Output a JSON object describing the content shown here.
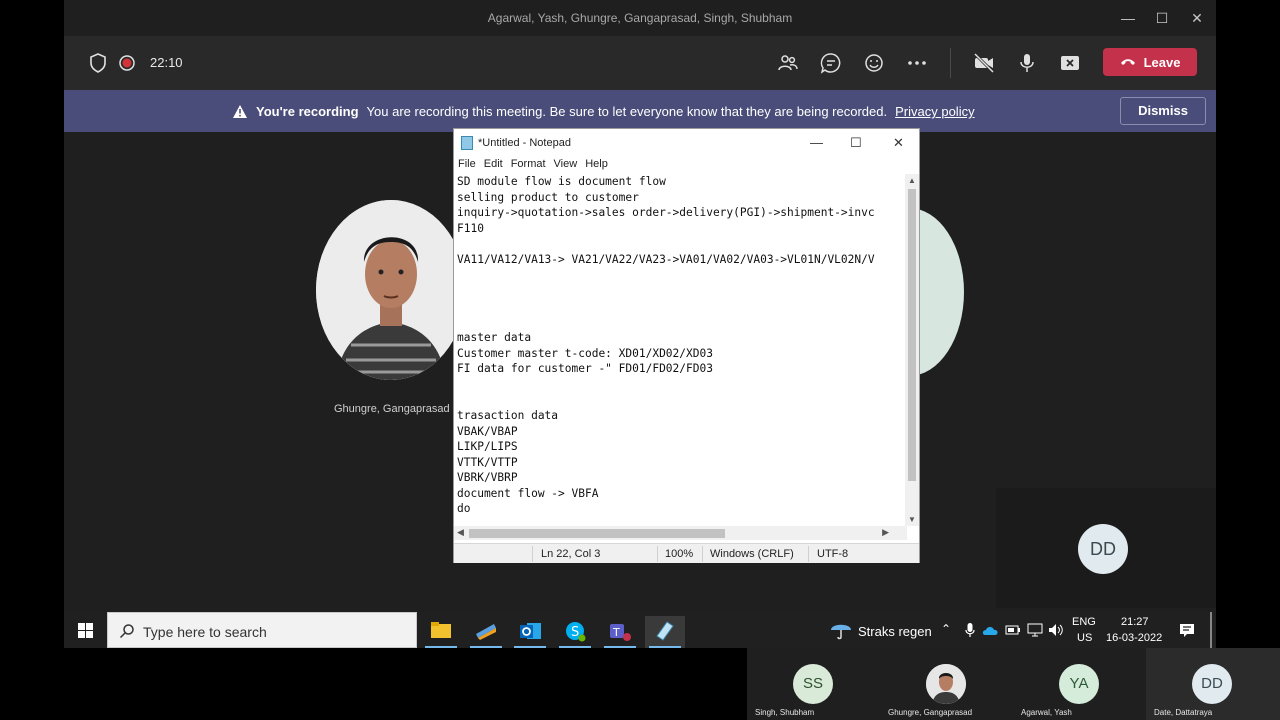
{
  "window": {
    "title": "Agarwal, Yash, Ghungre, Gangaprasad, Singh, Shubham"
  },
  "meeting": {
    "timer": "22:10",
    "leave_label": "Leave"
  },
  "banner": {
    "title": "You're recording",
    "message": "You are recording this meeting. Be sure to let everyone know that they are being recorded.",
    "link": "Privacy policy",
    "dismiss": "Dismiss"
  },
  "stage": {
    "participant_name": "Ghungre, Gangaprasad",
    "dd_initials": "DD"
  },
  "notepad": {
    "title": "*Untitled - Notepad",
    "menu": [
      "File",
      "Edit",
      "Format",
      "View",
      "Help"
    ],
    "content": "SD module flow is document flow\nselling product to customer\ninquiry->quotation->sales order->delivery(PGI)->shipment->invc\nF110\n\nVA11/VA12/VA13-> VA21/VA22/VA23->VA01/VA02/VA03->VL01N/VL02N/V\n\n\n\n\nmaster data\nCustomer master t-code: XD01/XD02/XD03\nFI data for customer -\" FD01/FD02/FD03\n\n\ntrasaction data\nVBAK/VBAP\nLIKP/LIPS\nVTTK/VTTP\nVBRK/VBRP\ndocument flow -> VBFA\ndo",
    "status": {
      "position": "Ln 22, Col 3",
      "zoom": "100%",
      "eol": "Windows (CRLF)",
      "encoding": "UTF-8"
    }
  },
  "taskbar": {
    "search_placeholder": "Type here to search",
    "weather": "Straks regen",
    "lang_top": "ENG",
    "lang_bottom": "US",
    "time": "21:27",
    "date": "16-03-2022"
  },
  "participants": [
    {
      "initials": "SS",
      "name": "Singh, Shubham",
      "color": "#d9ebd8",
      "text_color": "#2f4f2d"
    },
    {
      "initials": "",
      "name": "Ghungre, Gangaprasad",
      "color": "#e0e0e0",
      "text_color": "#333333"
    },
    {
      "initials": "YA",
      "name": "Agarwal, Yash",
      "color": "#d4ecd9",
      "text_color": "#2d5b39"
    },
    {
      "initials": "DD",
      "name": "Date, Dattatraya",
      "color": "#e1ebef",
      "text_color": "#3b4a52"
    }
  ],
  "colors": {
    "leave": "#c4314b",
    "banner": "#4a4d79",
    "toolbar": "#292929"
  }
}
